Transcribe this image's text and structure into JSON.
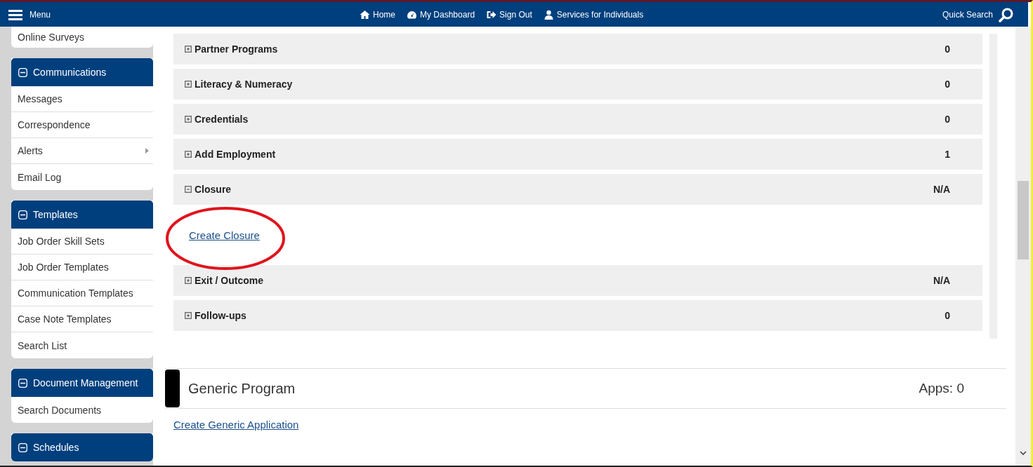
{
  "nav": {
    "menu": "Menu",
    "links": [
      {
        "label": "Home"
      },
      {
        "label": "My Dashboard"
      },
      {
        "label": "Sign Out"
      },
      {
        "label": "Services for Individuals"
      }
    ],
    "quick_search": "Quick Search"
  },
  "sidebar": {
    "top_items": [
      {
        "label": "Online Surveys",
        "submenu": false
      }
    ],
    "panels": [
      {
        "title": "Communications",
        "expanded": true,
        "items": [
          {
            "label": "Messages",
            "submenu": false
          },
          {
            "label": "Correspondence",
            "submenu": false
          },
          {
            "label": "Alerts",
            "submenu": true
          },
          {
            "label": "Email Log",
            "submenu": false
          }
        ]
      },
      {
        "title": "Templates",
        "expanded": true,
        "items": [
          {
            "label": "Job Order Skill Sets",
            "submenu": false
          },
          {
            "label": "Job Order Templates",
            "submenu": false
          },
          {
            "label": "Communication Templates",
            "submenu": false
          },
          {
            "label": "Case Note Templates",
            "submenu": false
          },
          {
            "label": "Search List",
            "submenu": false
          }
        ]
      },
      {
        "title": "Document Management",
        "expanded": true,
        "items": [
          {
            "label": "Search Documents",
            "submenu": false
          }
        ]
      },
      {
        "title": "Schedules",
        "expanded": true
      }
    ]
  },
  "sections": [
    {
      "title": "Partner Programs",
      "value": "0",
      "expanded": false
    },
    {
      "title": "Literacy & Numeracy",
      "value": "0",
      "expanded": false
    },
    {
      "title": "Credentials",
      "value": "0",
      "expanded": false
    },
    {
      "title": "Add Employment",
      "value": "1",
      "expanded": false
    },
    {
      "title": "Closure",
      "value": "N/A",
      "expanded": true,
      "link": "Create Closure",
      "circled": true
    },
    {
      "title": "Exit / Outcome",
      "value": "N/A",
      "expanded": false
    },
    {
      "title": "Follow-ups",
      "value": "0",
      "expanded": false
    }
  ],
  "program": {
    "title": "Generic Program",
    "apps": "Apps: 0",
    "link": "Create Generic Application"
  }
}
